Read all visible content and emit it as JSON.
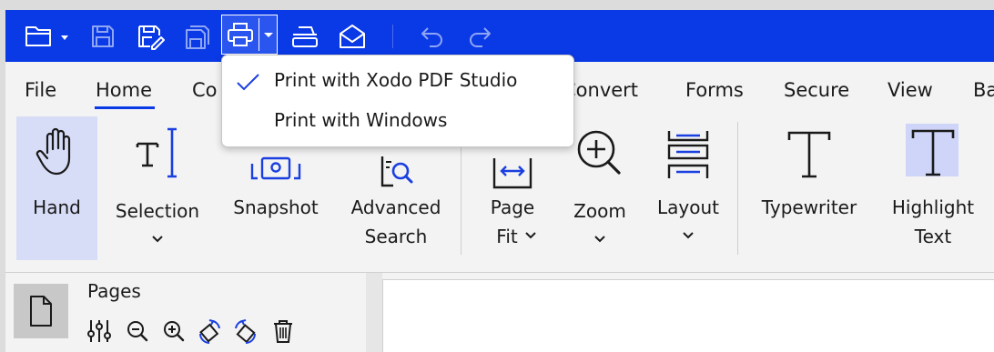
{
  "quick_access": {
    "items": [
      {
        "name": "open-folder",
        "icon": "folder-icon",
        "enabled": true
      },
      {
        "name": "save",
        "icon": "save-icon",
        "enabled": false
      },
      {
        "name": "save-as",
        "icon": "save-edit-icon",
        "enabled": true
      },
      {
        "name": "save-all",
        "icon": "save-all-icon",
        "enabled": false
      },
      {
        "name": "print",
        "icon": "printer-icon",
        "enabled": true,
        "has_dropdown": true
      },
      {
        "name": "scan",
        "icon": "scanner-icon",
        "enabled": true
      },
      {
        "name": "email",
        "icon": "envelope-icon",
        "enabled": true
      },
      {
        "name": "undo",
        "icon": "undo-icon",
        "enabled": false
      },
      {
        "name": "redo",
        "icon": "redo-icon",
        "enabled": false
      }
    ]
  },
  "menu_tabs": [
    {
      "label": "File",
      "active": false
    },
    {
      "label": "Home",
      "active": true
    },
    {
      "label": "Co",
      "active": false
    },
    {
      "label": "Convert",
      "active": false
    },
    {
      "label": "Forms",
      "active": false
    },
    {
      "label": "Secure",
      "active": false
    },
    {
      "label": "View",
      "active": false
    },
    {
      "label": "Ba",
      "active": false
    }
  ],
  "ribbon": {
    "hand": {
      "label": "Hand",
      "icon": "hand-icon",
      "active": true
    },
    "selection": {
      "label": "Selection",
      "icon": "text-cursor-icon"
    },
    "snapshot": {
      "label": "Snapshot",
      "icon": "camera-icon"
    },
    "advanced_search": {
      "line1": "Advanced",
      "line2": "Search",
      "icon": "document-search-icon"
    },
    "page_fit": {
      "line1": "Page",
      "line2": "Fit",
      "icon": "page-fit-icon"
    },
    "zoom": {
      "label": "Zoom",
      "icon": "zoom-in-icon"
    },
    "layout": {
      "label": "Layout",
      "icon": "layout-icon"
    },
    "typewriter": {
      "label": "Typewriter",
      "icon": "typewriter-t-icon"
    },
    "highlight_text": {
      "line1": "Highlight",
      "line2": "Text",
      "icon": "highlight-t-icon"
    }
  },
  "print_dropdown": {
    "items": [
      {
        "label": "Print with Xodo PDF Studio",
        "checked": true
      },
      {
        "label": "Print with Windows",
        "checked": false
      }
    ]
  },
  "pages_panel": {
    "title": "Pages",
    "tools": [
      "settings-sliders-icon",
      "zoom-out-icon",
      "zoom-in-icon",
      "rotate-left-icon",
      "rotate-right-icon",
      "trash-icon"
    ]
  },
  "colors": {
    "titlebar": "#0a39e6",
    "accent": "#0a39e6",
    "active_button": "#d7dcf7",
    "background": "#f3f3f3"
  }
}
